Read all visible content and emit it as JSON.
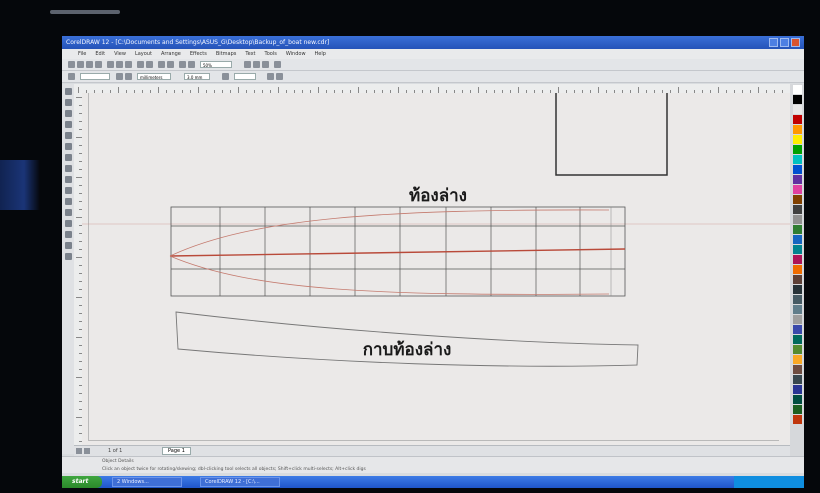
{
  "window": {
    "title": "CorelDRAW 12 - [C:\\Documents and Settings\\ASUS_G\\Desktop\\Backup_of_boat new.cdr]"
  },
  "menu": {
    "items": [
      "File",
      "Edit",
      "View",
      "Layout",
      "Arrange",
      "Effects",
      "Bitmaps",
      "Text",
      "Tools",
      "Window",
      "Help"
    ]
  },
  "toolbar": {
    "zoom_value": "50%",
    "font_size_value": "3.0 mm",
    "units_value": "millimeters"
  },
  "drawing": {
    "hull_label": "ท้องล่าง",
    "bottom_panel_label": "กาบท้องล่าง"
  },
  "page_tabs": {
    "counter": "1 of 1",
    "active_tab": "Page 1"
  },
  "status": {
    "line1": "Object Details",
    "line2": "Click an object twice for rotating/skewing; dbl-clicking tool selects all objects; Shift+click multi-selects; Alt+click digs"
  },
  "taskbar": {
    "start_label": "start",
    "items": [
      "2 Windows...",
      "CorelDRAW 12 - [C:\\..."
    ]
  },
  "colors": {
    "titlebar": "#2a5bc6",
    "hull_centerline": "#b94a3a",
    "grid_lines": "#555555"
  }
}
